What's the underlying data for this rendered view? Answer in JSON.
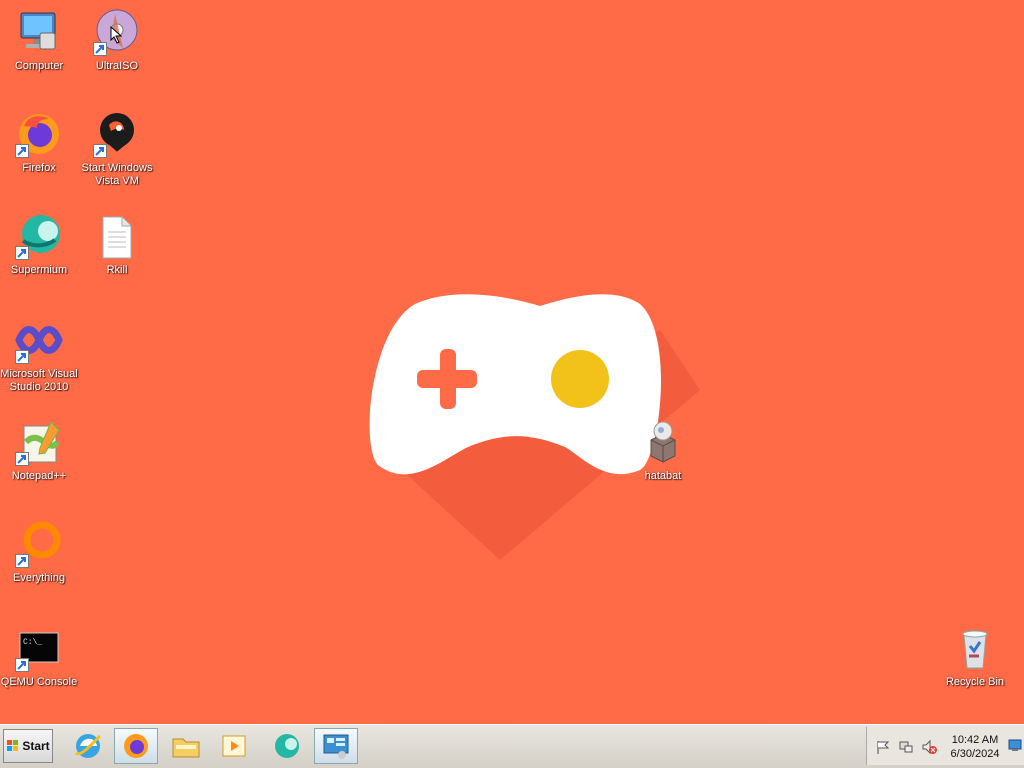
{
  "desktop": {
    "icons": [
      {
        "label": "Computer"
      },
      {
        "label": "UltraISO"
      },
      {
        "label": "Firefox"
      },
      {
        "label": "Start Windows\nVista VM"
      },
      {
        "label": "Supermium"
      },
      {
        "label": "Rkill"
      },
      {
        "label": "Microsoft Visual\nStudio 2010"
      },
      {
        "label": "Notepad++"
      },
      {
        "label": "Everything"
      },
      {
        "label": "QEMU Console"
      },
      {
        "label": "hatabat"
      },
      {
        "label": "Recycle Bin"
      }
    ]
  },
  "taskbar": {
    "start_label": "Start",
    "pinned": [
      "internet-explorer",
      "firefox",
      "file-explorer",
      "media-player",
      "supermium",
      "control-panel"
    ]
  },
  "tray": {
    "time": "10:42 AM",
    "date": "6/30/2024"
  },
  "colors": {
    "wallpaper": "#FF6A47",
    "controller": "#FFFFFF",
    "controller_accent": "#F2C21B"
  }
}
